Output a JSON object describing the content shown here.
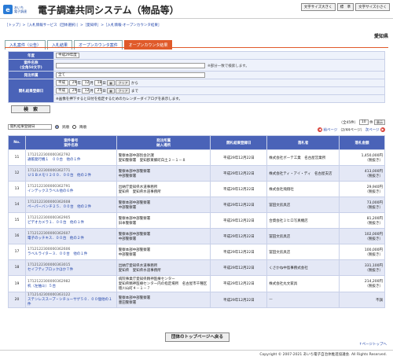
{
  "header": {
    "logo_line1": "あいち",
    "logo_line2": "電子調達",
    "title": "電子調達共同システム（物品等）",
    "size_large": "文字サイズ大きく",
    "size_standard": "標　準",
    "size_small": "文字サイズ小さく"
  },
  "breadcrumb": "［トップ］>［入札情報サービス（団体選択）］>［愛知県］>［入札情報-オープンカウンタ結果］",
  "region": "愛知県",
  "tabs": [
    {
      "label": "入札案件（公告）",
      "active": false
    },
    {
      "label": "入札結果",
      "active": false
    },
    {
      "label": "オープンカウンタ案件",
      "active": false
    },
    {
      "label": "オープンカウンタ結果",
      "active": true
    }
  ],
  "form": {
    "year_label": "年度",
    "year_value": "平成29年度",
    "case_label": "案件名称",
    "case_sub": "(全角50文字)",
    "case_note": "※部分一致で検索します。",
    "org_label": "発注所属",
    "org_value": "全て",
    "date_label": "開札結果登録日",
    "from_era": "平成",
    "from_year": "29",
    "from_month": "12",
    "from_day": "18",
    "to_era": "平成",
    "to_year": "29",
    "to_month": "12",
    "to_day": "25",
    "unit_year": "年",
    "unit_month": "月",
    "unit_day": "日",
    "clear": "クリア",
    "from_suffix": "から",
    "to_suffix": "まで",
    "calendar_note": "※画像を押下すると日付を指定するためのカレンダーダイアログを表示します。",
    "search_button": "検　索"
  },
  "sort": {
    "select_value": "開札結果登録日",
    "asc": "昇順",
    "desc": "降順"
  },
  "pager": {
    "summary": "全45件",
    "page_select": "10",
    "unit": "件",
    "display": "表示",
    "prev": "前ページ",
    "page_info": "（2/44ページ）",
    "next": "次ページ"
  },
  "table": {
    "headers": [
      "No.",
      "案件番号\n案件名称",
      "発注所属\n納入場所",
      "開札結果登録日",
      "落札者",
      "落札金額"
    ],
    "rows": [
      {
        "no": "11",
        "id": "17121223000003627​92",
        "name": "通帳発行機１　００台　他の１件",
        "org": "警察本部中部別会計課",
        "place": "愛知警察署　愛知郡東郷町白土２－１－８",
        "date": "平成29年12月22日",
        "winner": "株式会社ボーテ工業　名古屋営業所",
        "amount": "1,450,000円",
        "tax": "（税抜き）"
      },
      {
        "no": "12",
        "id": "17121223000003627​71",
        "name": "ＵＳＢメモリ２００．００台　他の２件",
        "org": "警察本部中部警察署",
        "place": "中部警察署",
        "date": "平成29年12月22日",
        "winner": "株式会社ティ・アイ・ディ　名古屋支店",
        "amount": "413,000円",
        "tax": "（税抜き）"
      },
      {
        "no": "13",
        "id": "17121223000003627​91",
        "name": "インデックスラベル他の６件",
        "org": "出納庁愛知県水道事務所",
        "place": "愛知県　愛知県水道事務所",
        "date": "平成29年12月22日",
        "winner": "株式会社飛翔社",
        "amount": "29,940円",
        "tax": "（税抜き）"
      },
      {
        "no": "14",
        "id": "17121223000003626​08",
        "name": "ペーパーバンチ２５．００台　他の２件",
        "org": "警察本部中部警察署",
        "place": "中部警察署",
        "date": "平成29年12月22日",
        "winner": "冨田文房具店",
        "amount": "73,000円",
        "tax": "（税抜き）"
      },
      {
        "no": "15",
        "id": "17121223000003629​05",
        "name": "ピデオカメラ１．００台　他の１件",
        "org": "警察本部中部警察署",
        "place": "旧本警察署",
        "date": "平成29年12月22日",
        "winner": "合資会社ミヒロ写真機店",
        "amount": "81,200円",
        "tax": "（税抜き）"
      },
      {
        "no": "16",
        "id": "17121223000003626​07",
        "name": "電子のッチキス．００台　他の２件",
        "org": "警察本部中部警察署",
        "place": "中部警察署",
        "date": "平成29年12月22日",
        "winner": "冨田文房具店",
        "amount": "102,000円",
        "tax": "（税抜き）"
      },
      {
        "no": "17",
        "id": "17121223000003626​06",
        "name": "ラベルライター３．００台　他の１件",
        "org": "警察本部中部警察署",
        "place": "中部警察署",
        "date": "平成29年12月22日",
        "winner": "冨田文房具店",
        "amount": "100,000円",
        "tax": "（税抜き）"
      },
      {
        "no": "18",
        "id": "17121223000003630​15",
        "name": "セイフティブロックほか７件",
        "org": "出納庁愛知県水道事務所",
        "place": "愛知県　愛知県水道事務所",
        "date": "平成29年12月22日",
        "winner": "くさかね中島事務式会社",
        "amount": "331,100円",
        "tax": "（税抜き）"
      },
      {
        "no": "19",
        "id": "17121223000003629​82",
        "name": "机（左抽斗）５台",
        "org": "病院事業庁愛知県精神医療センター",
        "place": "愛知県精神医療センター内の指定場所　名古屋市千種区徳川山町４－１－７",
        "date": "平成29年12月22日",
        "winner": "株式会社丸文家具",
        "amount": "214,200円",
        "tax": "（税抜き）"
      },
      {
        "no": "20",
        "id": "17121423000003631​22",
        "name": "ステンレススープ・シチューサゲ５０．００個他の１件",
        "org": "警察本部中部警察署",
        "place": "豊田警察署",
        "date": "平成29年12月22日",
        "winner": "—",
        "amount": "不調",
        "tax": ""
      }
    ]
  },
  "back_button": "団体のトップページへ戻る",
  "page_top": "↑ページトップへ",
  "footer": "Copyright © 2007-2021 あいち電子自治体推進協議会. All Rights Reserved."
}
